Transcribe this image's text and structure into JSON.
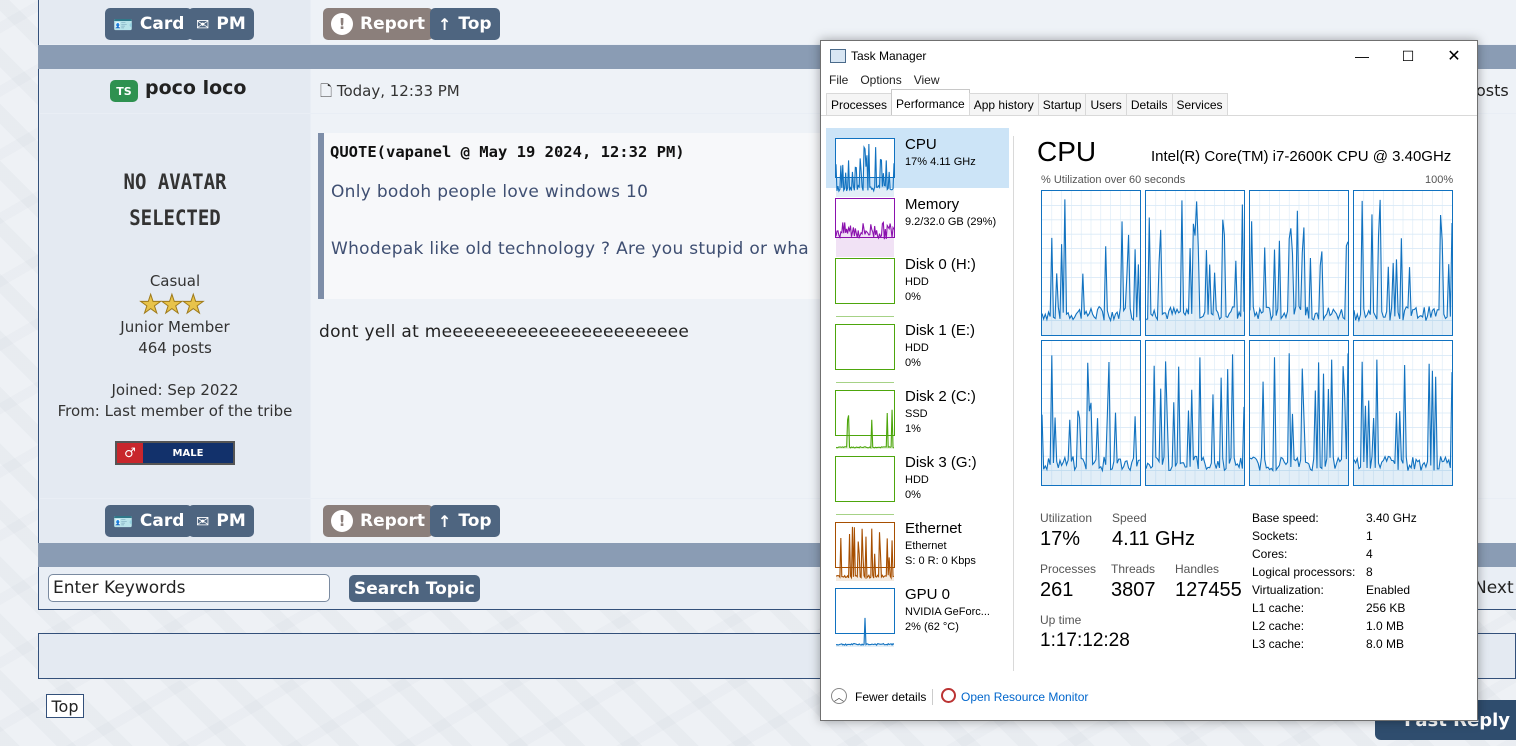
{
  "forum": {
    "buttons": {
      "card": "Card",
      "pm": "PM",
      "report": "Report",
      "top": "Top"
    },
    "post": {
      "user_badge": "TS",
      "username": "poco loco",
      "date": "Today, 12:33 PM",
      "avatar_line1": "NO AVATAR",
      "avatar_line2": "SELECTED",
      "user_title": "Casual",
      "stars": "★★★",
      "rank": "Junior Member",
      "post_count": "464 posts",
      "joined": "Joined: Sep 2022",
      "from": "From: Last member of the tribe",
      "gender_badge": "MALE",
      "gender_symbol": "♂",
      "quote_header": "QUOTE(vapanel @ May 19 2024, 12:32 PM)",
      "quote_line1": "Only bodoh people love windows 10",
      "quote_line2": "Whodepak like old technology ? Are you stupid or wha",
      "reply": "dont yell at meeeeeeeeeeeeeeeeeeeeeee"
    },
    "search": {
      "placeholder": "Enter Keywords",
      "button": "Search Topic"
    },
    "top_link": "Top",
    "right_fragment_posts": "osts",
    "right_fragment_next": "Next",
    "fast_reply": "Fast Reply"
  },
  "task_manager": {
    "title": "Task Manager",
    "window_controls": {
      "minimize": "—",
      "maximize": "☐",
      "close": "✕"
    },
    "menu": [
      "File",
      "Options",
      "View"
    ],
    "tabs": [
      "Processes",
      "Performance",
      "App history",
      "Startup",
      "Users",
      "Details",
      "Services"
    ],
    "active_tab": "Performance",
    "sidebar": [
      {
        "name": "CPU",
        "line1": "17% 4.11 GHz",
        "line2": "",
        "color": "#1172c0"
      },
      {
        "name": "Memory",
        "line1": "9.2/32.0 GB (29%)",
        "line2": "",
        "color": "#8b12ae"
      },
      {
        "name": "Disk 0 (H:)",
        "line1": "HDD",
        "line2": "0%",
        "color": "#4da60c"
      },
      {
        "name": "Disk 1 (E:)",
        "line1": "HDD",
        "line2": "0%",
        "color": "#4da60c"
      },
      {
        "name": "Disk 2 (C:)",
        "line1": "SSD",
        "line2": "1%",
        "color": "#4da60c"
      },
      {
        "name": "Disk 3 (G:)",
        "line1": "HDD",
        "line2": "0%",
        "color": "#4da60c"
      },
      {
        "name": "Ethernet",
        "line1": "Ethernet",
        "line2": "S: 0 R: 0 Kbps",
        "color": "#a74f01"
      },
      {
        "name": "GPU 0",
        "line1": "NVIDIA GeForc...",
        "line2": "2% (62 °C)",
        "color": "#1172c0"
      }
    ],
    "cpu": {
      "heading": "CPU",
      "model": "Intel(R) Core(TM) i7-2600K CPU @ 3.40GHz",
      "graph_caption": "% Utilization over 60 seconds",
      "graph_max": "100%",
      "stats": {
        "utilization_label": "Utilization",
        "utilization": "17%",
        "speed_label": "Speed",
        "speed": "4.11 GHz",
        "processes_label": "Processes",
        "processes": "261",
        "threads_label": "Threads",
        "threads": "3807",
        "handles_label": "Handles",
        "handles": "127455",
        "uptime_label": "Up time",
        "uptime": "1:17:12:28"
      },
      "specs": [
        {
          "label": "Base speed:",
          "value": "3.40 GHz"
        },
        {
          "label": "Sockets:",
          "value": "1"
        },
        {
          "label": "Cores:",
          "value": "4"
        },
        {
          "label": "Logical processors:",
          "value": "8"
        },
        {
          "label": "Virtualization:",
          "value": "Enabled"
        },
        {
          "label": "L1 cache:",
          "value": "256 KB"
        },
        {
          "label": "L2 cache:",
          "value": "1.0 MB"
        },
        {
          "label": "L3 cache:",
          "value": "8.0 MB"
        }
      ]
    },
    "footer": {
      "fewer_details": "Fewer details",
      "resource_monitor": "Open Resource Monitor"
    }
  }
}
